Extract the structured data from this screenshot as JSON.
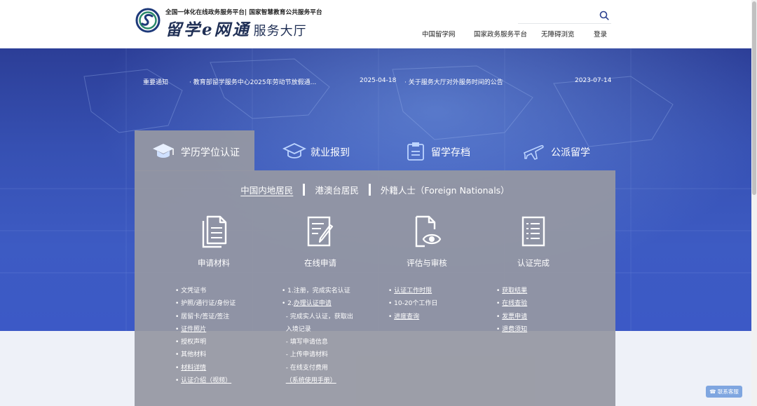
{
  "header": {
    "logo_top": "全国一体化在线政务服务平台| 国家智慧教育公共服务平台",
    "logo_brand": "留学e网通",
    "logo_sub": "服务大厅",
    "search": {
      "value": "",
      "placeholder": ""
    },
    "nav": [
      "中国留学网",
      "国家政务服务平台",
      "无障碍浏览",
      "登录"
    ]
  },
  "notices": {
    "label": "重要通知",
    "items": [
      {
        "title": "· 教育部留学服务中心2025年劳动节放假通...",
        "date": "2025-04-18"
      },
      {
        "title": "· 关于服务大厅对外服务时间的公告",
        "date": "2023-07-14"
      }
    ]
  },
  "tabs": [
    {
      "label": "学历学位认证",
      "icon": "graduation-cap-icon",
      "active": true
    },
    {
      "label": "就业报到",
      "icon": "mortarboard-icon",
      "active": false
    },
    {
      "label": "留学存档",
      "icon": "archive-icon",
      "active": false
    },
    {
      "label": "公派留学",
      "icon": "airplane-icon",
      "active": false
    }
  ],
  "sub_tabs": [
    {
      "label": "中国内地居民",
      "active": true
    },
    {
      "label": "港澳台居民",
      "active": false
    },
    {
      "label": "外籍人士（Foreign Nationals）",
      "active": false
    }
  ],
  "steps": [
    {
      "label": "申请材料",
      "icon": "documents-icon"
    },
    {
      "label": "在线申请",
      "icon": "form-edit-icon"
    },
    {
      "label": "评估与审核",
      "icon": "document-eye-icon"
    },
    {
      "label": "认证完成",
      "icon": "checklist-icon"
    }
  ],
  "columns": [
    [
      {
        "bullet": "• ",
        "prefix": "",
        "text": "文凭证书",
        "link": false
      },
      {
        "bullet": "• ",
        "prefix": "",
        "text": "护照/通行证/身份证",
        "link": false
      },
      {
        "bullet": "• ",
        "prefix": "",
        "text": "居留卡/签证/签注",
        "link": false
      },
      {
        "bullet": "• ",
        "prefix": "",
        "text": "证件照片",
        "link": true
      },
      {
        "bullet": "• ",
        "prefix": "",
        "text": "授权声明",
        "link": false
      },
      {
        "bullet": "• ",
        "prefix": "",
        "text": "其他材料",
        "link": false
      },
      {
        "bullet": "• ",
        "prefix": "",
        "text": "材料详情",
        "link": true
      },
      {
        "bullet": "• ",
        "prefix": "",
        "text": "认证介绍（视频）",
        "link": true
      }
    ],
    [
      {
        "bullet": "• ",
        "prefix": "",
        "text": "1.注册，完成实名认证",
        "link": false
      },
      {
        "bullet": "• ",
        "prefix": "2.",
        "text": "办理认证申请",
        "link": true
      },
      {
        "bullet": "",
        "prefix": "",
        "text": "  - 完成实人认证，获取出",
        "link": false
      },
      {
        "bullet": "",
        "prefix": "",
        "text": "  入境记录",
        "link": false
      },
      {
        "bullet": "",
        "prefix": "",
        "text": "  - 填写申请信息",
        "link": false
      },
      {
        "bullet": "",
        "prefix": "",
        "text": "  - 上传申请材料",
        "link": false
      },
      {
        "bullet": "",
        "prefix": "",
        "text": "  - 在线支付费用",
        "link": false
      },
      {
        "bullet": "",
        "prefix": "  ",
        "text": "（系统使用手册）",
        "link": true
      }
    ],
    [
      {
        "bullet": "• ",
        "prefix": "",
        "text": "认证工作时限",
        "link": true
      },
      {
        "bullet": "• ",
        "prefix": "",
        "text": "10-20个工作日",
        "link": false
      },
      {
        "bullet": "• ",
        "prefix": "",
        "text": "进度查询",
        "link": true
      }
    ],
    [
      {
        "bullet": "• ",
        "prefix": "",
        "text": "获取结果",
        "link": true
      },
      {
        "bullet": "• ",
        "prefix": "",
        "text": "在线查验",
        "link": true
      },
      {
        "bullet": "• ",
        "prefix": "",
        "text": "发票申请",
        "link": true
      },
      {
        "bullet": "• ",
        "prefix": "",
        "text": "退费须知",
        "link": true
      }
    ]
  ],
  "service_button": "联系客服",
  "colors": {
    "banner": "#3650b2",
    "panel": "#96989f",
    "brand_text": "#1f2f55",
    "service_btn": "#7fa6e0"
  }
}
